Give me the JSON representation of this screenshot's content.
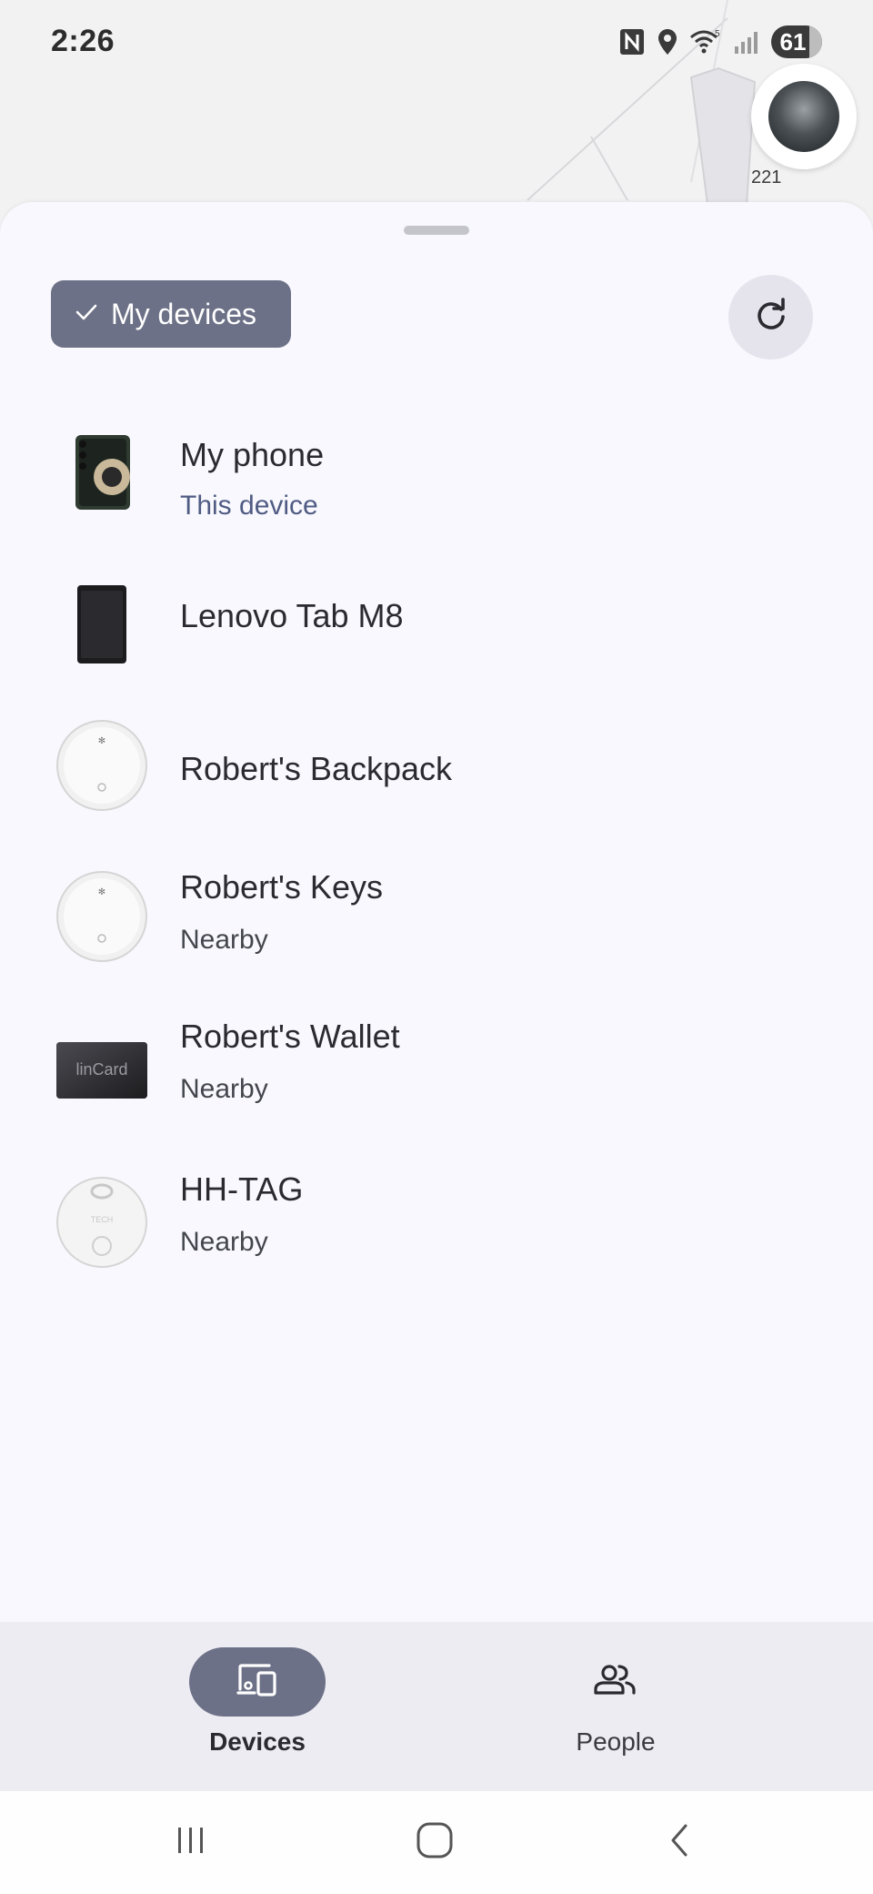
{
  "status_bar": {
    "time": "2:26",
    "battery_level": "61",
    "icons": [
      "nfc-icon",
      "location-icon",
      "wifi-icon",
      "signal-icon",
      "battery-icon"
    ]
  },
  "map": {
    "avatar_label": "221"
  },
  "sheet": {
    "filter_chip_label": "My devices",
    "refresh_icon": "refresh-icon"
  },
  "devices": [
    {
      "name": "My phone",
      "status": "This device",
      "thumb": "phone"
    },
    {
      "name": "Lenovo Tab M8",
      "status": "",
      "thumb": "tablet"
    },
    {
      "name": "Robert's Backpack",
      "status": "",
      "thumb": "tag-round"
    },
    {
      "name": "Robert's Keys",
      "status": "Nearby",
      "thumb": "tag-round"
    },
    {
      "name": "Robert's Wallet",
      "status": "Nearby",
      "thumb": "card",
      "thumb_text": "linCard"
    },
    {
      "name": "HH-TAG",
      "status": "Nearby",
      "thumb": "tag-loop",
      "thumb_text": "TECH"
    }
  ],
  "bottom_nav": {
    "items": [
      {
        "label": "Devices",
        "icon": "devices-icon",
        "active": true
      },
      {
        "label": "People",
        "icon": "people-icon",
        "active": false
      }
    ]
  },
  "system_nav": {
    "buttons": [
      "recents-icon",
      "home-icon",
      "back-icon"
    ]
  },
  "colors": {
    "accent": "#6c7187",
    "sheet_bg": "#f9f8fe",
    "nav_bg": "#edecf3",
    "subtitle_accent": "#4f5b83"
  }
}
